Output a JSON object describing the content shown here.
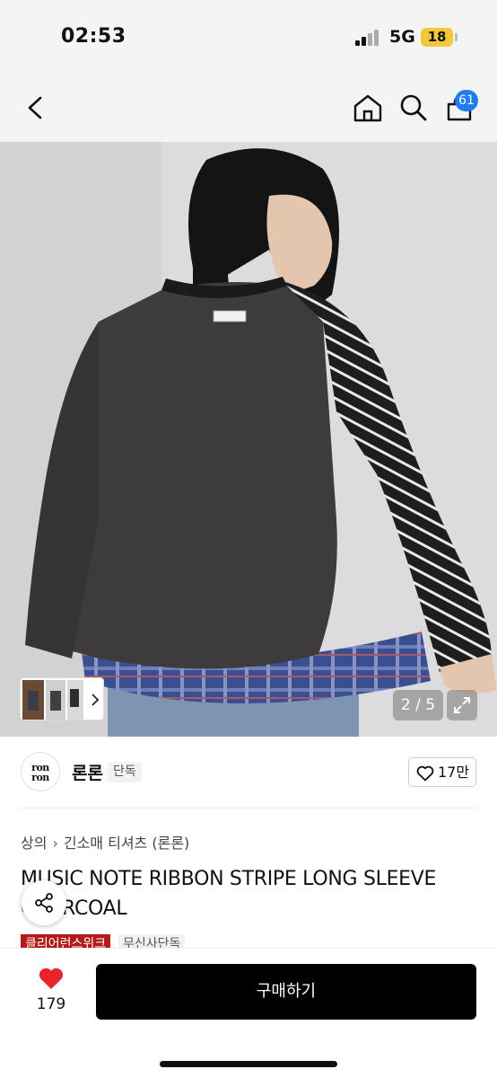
{
  "status_bar": {
    "time": "02:53",
    "network": "5G",
    "battery": "18"
  },
  "nav": {
    "back_icon": "chevron-left-icon",
    "home_icon": "home-icon",
    "search_icon": "search-icon",
    "cart_icon": "shopping-bag-icon",
    "cart_count": "61"
  },
  "gallery": {
    "page_indicator": "2 / 5",
    "current_page": 2,
    "total_pages": 5,
    "expand_icon": "expand-icon"
  },
  "brand": {
    "logo_text": [
      "ron",
      "ron"
    ],
    "name": "론론",
    "tag": "단독",
    "like_count": "17만"
  },
  "breadcrumb": {
    "category": "상의",
    "subcategory": "긴소매 티셔츠 (론론)"
  },
  "product": {
    "title": "MUSIC NOTE RIBBON STRIPE LONG SLEEVE CHARCOAL"
  },
  "badges": {
    "clearance": "클리어런스위크",
    "exclusive": "무신사단독"
  },
  "bottom": {
    "wish_count": "179",
    "buy_label": "구매하기"
  },
  "colors": {
    "accent_blue": "#1c7ef2",
    "badge_red": "#b31b1b",
    "heart_red": "#e8242b",
    "buy_black": "#000000"
  }
}
